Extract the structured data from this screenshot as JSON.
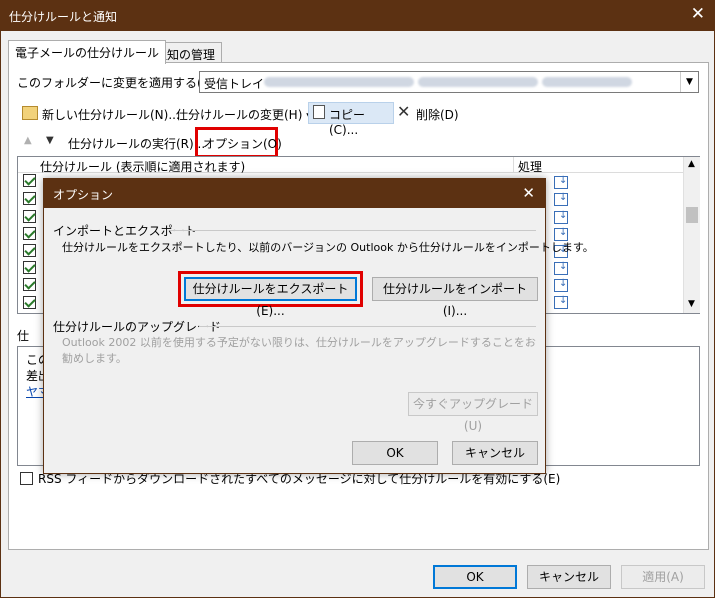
{
  "window": {
    "title": "仕分けルールと通知",
    "close": "✕"
  },
  "tabs": [
    {
      "label": "電子メールの仕分けルール"
    },
    {
      "label": "通知の管理"
    }
  ],
  "folder": {
    "label": "このフォルダーに変更を適用する(F):",
    "value": "受信トレイ"
  },
  "toolbar": {
    "new_rule": "新しい仕分けルール(N)...",
    "change_rule": "仕分けルールの変更(H)",
    "copy": "コピー(C)...",
    "delete": "削除(D)",
    "run_rules": "仕分けルールの実行(R)...",
    "options": "オプション(O)"
  },
  "list": {
    "col_rule": "仕分けルール (表示順に適用されます)",
    "col_action": "処理"
  },
  "description": {
    "label": "仕",
    "lines": [
      "この",
      "差出",
      "ヤマ"
    ]
  },
  "rss": {
    "label": "RSS フィードからダウンロードされたすべてのメッセージに対して仕分けルールを有効にする(E)"
  },
  "footer": {
    "ok": "OK",
    "cancel": "キャンセル",
    "apply": "適用(A)"
  },
  "dialog": {
    "title": "オプション",
    "close": "✕",
    "import_export": {
      "heading": "インポートとエクスポート",
      "desc": "仕分けルールをエクスポートしたり、以前のバージョンの Outlook から仕分けルールをインポートします。",
      "export_btn": "仕分けルールをエクスポート(E)...",
      "import_btn": "仕分けルールをインポート(I)..."
    },
    "upgrade": {
      "heading": "仕分けルールのアップグレード",
      "desc": "Outlook 2002 以前を使用する予定がない限りは、仕分けルールをアップグレードすることをお勧めします。",
      "upgrade_btn": "今すぐアップグレード(U)"
    },
    "ok": "OK",
    "cancel": "キャンセル"
  }
}
